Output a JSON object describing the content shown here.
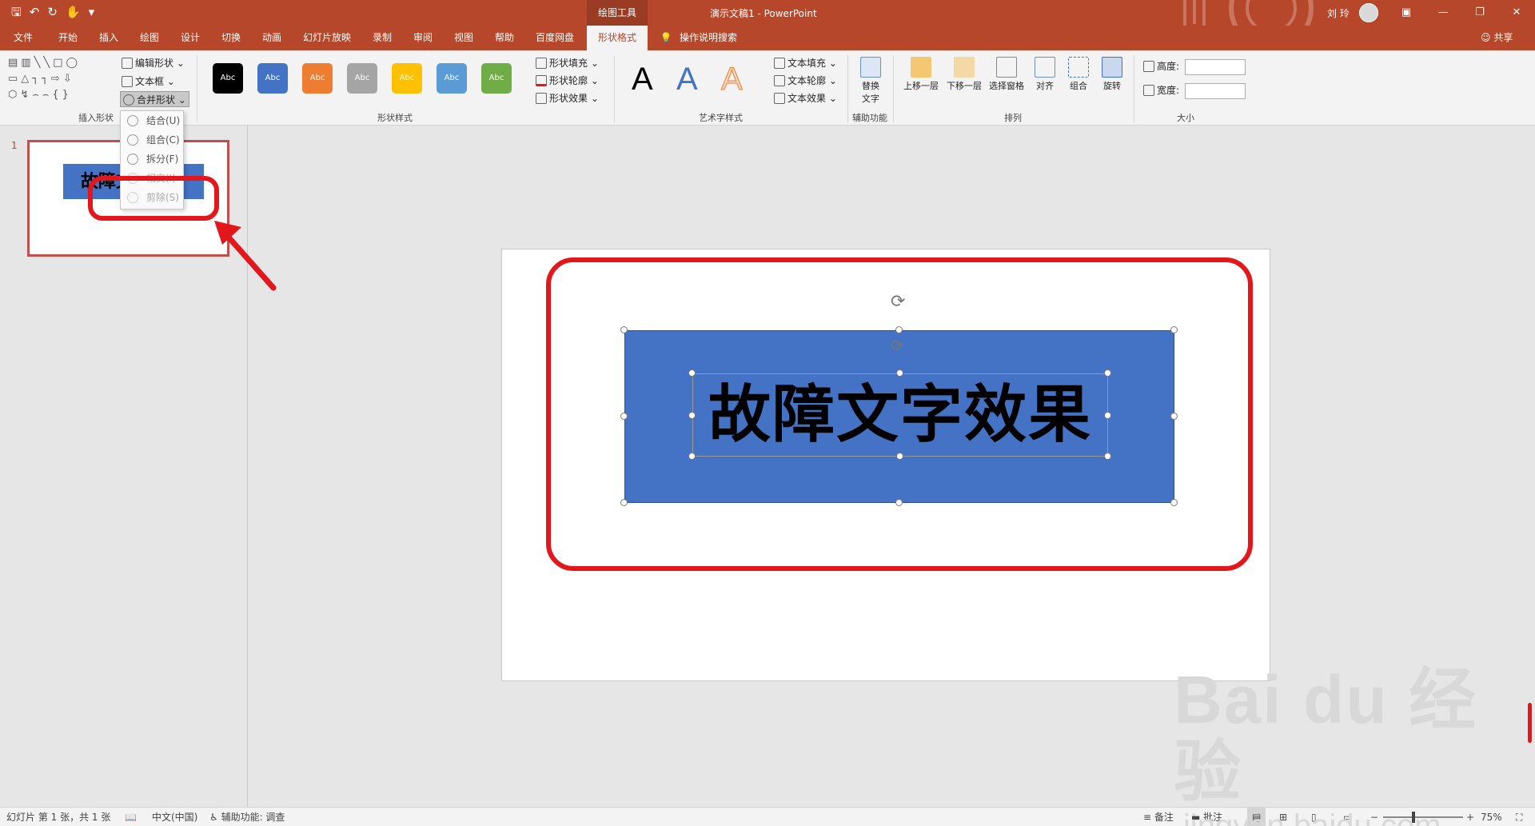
{
  "titlebar": {
    "tools_tab": "绘图工具",
    "title": "演示文稿1  -  PowerPoint",
    "user": "刘 玲",
    "qat": [
      "save-icon",
      "undo-icon",
      "redo-icon",
      "touch-icon",
      "customize-icon"
    ]
  },
  "tabs": [
    "文件",
    "开始",
    "插入",
    "绘图",
    "设计",
    "切换",
    "动画",
    "幻灯片放映",
    "录制",
    "审阅",
    "视图",
    "帮助",
    "百度网盘",
    "形状格式",
    "操作说明搜索"
  ],
  "active_tab": "形状格式",
  "share": "共享",
  "ribbon": {
    "insert_shapes": {
      "edit_shape": "编辑形状",
      "text_box": "文本框",
      "merge_shapes": "合并形状",
      "label": "插入形状"
    },
    "shape_styles": {
      "swatch_text": "Abc",
      "fill": "形状填充",
      "outline": "形状轮廓",
      "effects": "形状效果",
      "label": "形状样式",
      "swatch_colors": [
        "#000000",
        "#4472c4",
        "#ed7d31",
        "#a5a5a5",
        "#ffc000",
        "#5b9bd5",
        "#70ad47"
      ]
    },
    "wordart": {
      "letter": "A",
      "text_fill": "文本填充",
      "text_outline": "文本轮廓",
      "text_effects": "文本效果",
      "label": "艺术字样式"
    },
    "accessibility": {
      "alt_text_1": "替换",
      "alt_text_2": "文字",
      "label": "辅助功能"
    },
    "arrange": {
      "bring_forward": "上移一层",
      "send_backward": "下移一层",
      "selection_pane": "选择窗格",
      "align": "对齐",
      "group": "组合",
      "rotate": "旋转",
      "label": "排列"
    },
    "size": {
      "height": "高度:",
      "width": "宽度:",
      "label": "大小"
    }
  },
  "merge_menu": [
    "结合(U)",
    "组合(C)",
    "拆分(F)",
    "相交(I)",
    "剪除(S)"
  ],
  "thumbnail": {
    "number": "1",
    "text": "故障文"
  },
  "slide": {
    "text": "故障文字效果"
  },
  "status": {
    "slide_info": "幻灯片 第 1 张，共 1 张",
    "language": "中文(中国)",
    "accessibility": "辅助功能: 调查",
    "notes": "备注",
    "comments": "批注",
    "zoom": "75%"
  },
  "watermark": {
    "brand": "Bai du 经验",
    "url": "jingyan.baidu.com"
  }
}
